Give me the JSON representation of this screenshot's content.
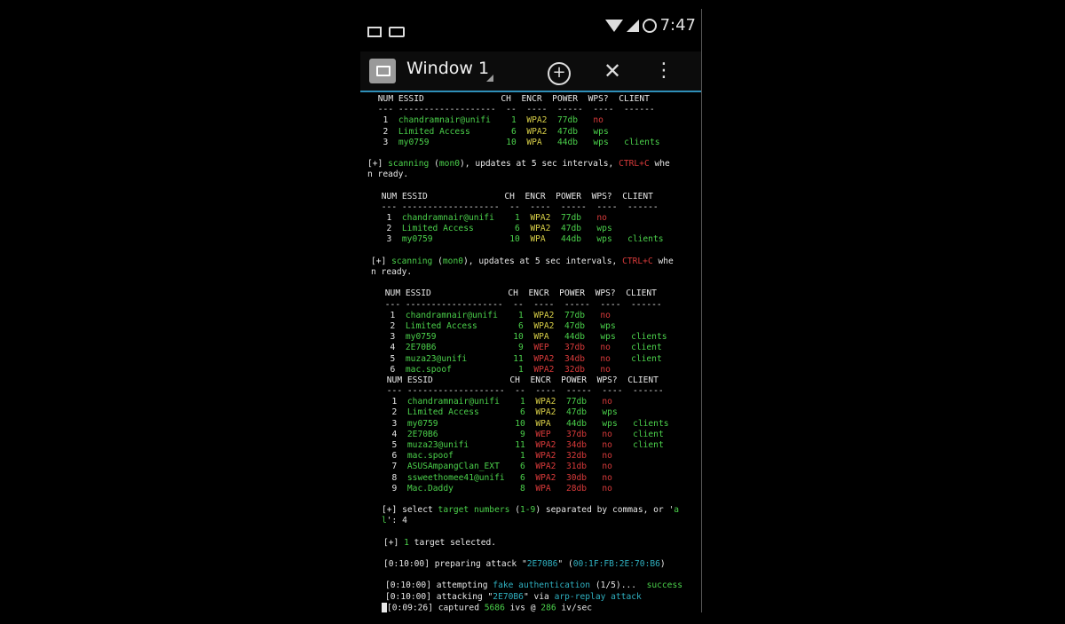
{
  "status_bar": {
    "clock": "7:47"
  },
  "action_bar": {
    "title": "Window 1",
    "add_icon": "plus-circle-icon",
    "close_icon": "close-icon",
    "menu_icon": "more-vert-icon"
  },
  "colors": {
    "accent": "#2f8fb8",
    "green": "#4bd14b",
    "yellow": "#d8cf47",
    "red": "#d83a3a",
    "cyan": "#2fb0c0"
  },
  "terminal": {
    "header": {
      "num_essid": "NUM ESSID",
      "ch": "CH",
      "encr": "ENCR",
      "power": "POWER",
      "wps": "WPS?",
      "client": "CLIENT"
    },
    "scan1": {
      "rows": [
        {
          "num": "1",
          "essid": "chandramnair@unifi",
          "ch": "1",
          "encr": "WPA2",
          "power": "77db",
          "wps": "no",
          "client": ""
        },
        {
          "num": "2",
          "essid": "Limited Access",
          "ch": "6",
          "encr": "WPA2",
          "power": "47db",
          "wps": "wps",
          "client": ""
        },
        {
          "num": "3",
          "essid": "my0759",
          "ch": "10",
          "encr": "WPA",
          "power": "44db",
          "wps": "wps",
          "client": "clients"
        }
      ]
    },
    "scan_msg": {
      "prefix": "[+] ",
      "scanning": "scanning",
      "iface": "mon0",
      "mid": "), updates at 5 sec intervals, ",
      "ctrlc": "CTRL+C",
      "tail": " whe",
      "line2": "n ready."
    },
    "scan3": {
      "rows": [
        {
          "num": "1",
          "essid": "chandramnair@unifi",
          "ch": "1",
          "encr": "WPA2",
          "power": "77db",
          "wps": "no",
          "client": ""
        },
        {
          "num": "2",
          "essid": "Limited Access",
          "ch": "6",
          "encr": "WPA2",
          "power": "47db",
          "wps": "wps",
          "client": ""
        },
        {
          "num": "3",
          "essid": "my0759",
          "ch": "10",
          "encr": "WPA",
          "power": "44db",
          "wps": "wps",
          "client": "clients"
        },
        {
          "num": "4",
          "essid": "2E70B6",
          "ch": "9",
          "encr": "WEP",
          "power": "37db",
          "wps": "no",
          "client": "client"
        },
        {
          "num": "5",
          "essid": "muza23@unifi",
          "ch": "11",
          "encr": "WPA2",
          "power": "34db",
          "wps": "no",
          "client": "client"
        },
        {
          "num": "6",
          "essid": "mac.spoof",
          "ch": "1",
          "encr": "WPA2",
          "power": "32db",
          "wps": "no",
          "client": ""
        }
      ]
    },
    "scan4": {
      "rows": [
        {
          "num": "1",
          "essid": "chandramnair@unifi",
          "ch": "1",
          "encr": "WPA2",
          "power": "77db",
          "wps": "no",
          "client": ""
        },
        {
          "num": "2",
          "essid": "Limited Access",
          "ch": "6",
          "encr": "WPA2",
          "power": "47db",
          "wps": "wps",
          "client": ""
        },
        {
          "num": "3",
          "essid": "my0759",
          "ch": "10",
          "encr": "WPA",
          "power": "44db",
          "wps": "wps",
          "client": "clients"
        },
        {
          "num": "4",
          "essid": "2E70B6",
          "ch": "9",
          "encr": "WEP",
          "power": "37db",
          "wps": "no",
          "client": "client"
        },
        {
          "num": "5",
          "essid": "muza23@unifi",
          "ch": "11",
          "encr": "WPA2",
          "power": "34db",
          "wps": "no",
          "client": "client"
        },
        {
          "num": "6",
          "essid": "mac.spoof",
          "ch": "1",
          "encr": "WPA2",
          "power": "32db",
          "wps": "no",
          "client": ""
        },
        {
          "num": "7",
          "essid": "ASUSAmpangClan_EXT",
          "ch": "6",
          "encr": "WPA2",
          "power": "31db",
          "wps": "no",
          "client": ""
        },
        {
          "num": "8",
          "essid": "ssweethomee41@unifi",
          "ch": "6",
          "encr": "WPA2",
          "power": "30db",
          "wps": "no",
          "client": ""
        },
        {
          "num": "9",
          "essid": "Mac.Daddy",
          "ch": "8",
          "encr": "WPA",
          "power": "28db",
          "wps": "no",
          "client": ""
        }
      ]
    },
    "select": {
      "prefix": "[+] select ",
      "target_numbers": "target numbers",
      "range": "1-9",
      "mid": " separated by commas, or '",
      "all": "a",
      "line2_pre": "l",
      "line2_post": "': 4"
    },
    "selected": {
      "prefix": "[+] ",
      "count": "1",
      "text": " target selected."
    },
    "preparing": {
      "time": "[0:10:00]",
      "text": " preparing attack \"",
      "essid": "2E70B6",
      "mid": "\" (",
      "mac": "00:1F:FB:2E:70:B6",
      "end": ")"
    },
    "attempting": {
      "time": "[0:10:00]",
      "text": " attempting ",
      "method": "fake authentication",
      "count": " (1/5)...",
      "result": "  success"
    },
    "attacking": {
      "time": "[0:10:00]",
      "text": " attacking \"",
      "essid": "2E70B6",
      "via": "\" via ",
      "method": "arp-replay attack"
    },
    "captured": {
      "time": "[0:09:26]",
      "text": " captured ",
      "ivs": "5686",
      "mid": " ivs @ ",
      "rate": "286",
      "unit": " iv/sec"
    }
  }
}
